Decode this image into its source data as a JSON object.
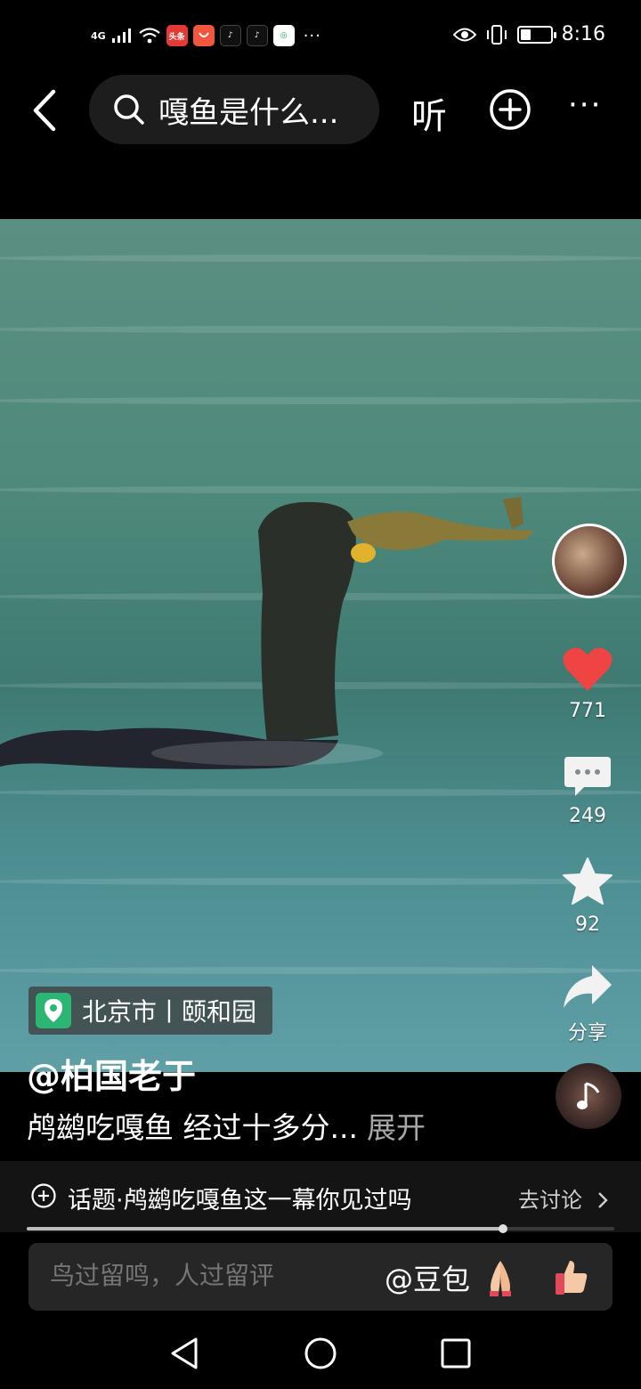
{
  "status_bar": {
    "network": "4G",
    "apps": [
      "头条",
      "HUAWEI",
      "精选"
    ],
    "more": "···",
    "time": "8:16",
    "battery_level": 0.35
  },
  "top_bar": {
    "search_query": "嘎鱼是什么...",
    "listen_label": "听"
  },
  "video": {
    "location": "北京市丨颐和园",
    "username": "@柏国老于",
    "caption": "鸬鹚吃嘎鱼 经过十多分...",
    "expand_label": "展开"
  },
  "actions": {
    "likes": "771",
    "comments": "249",
    "favorites": "92",
    "share_label": "分享"
  },
  "topic": {
    "text": "话题·鸬鹚吃嘎鱼这一幕你见过吗",
    "link": "去讨论"
  },
  "playback_progress": 0.81,
  "comment": {
    "placeholder": "鸟过留鸣，人过留评",
    "mention": "@豆包"
  },
  "colors": {
    "like_red": "#ef4444",
    "location_green": "#2bb673"
  }
}
